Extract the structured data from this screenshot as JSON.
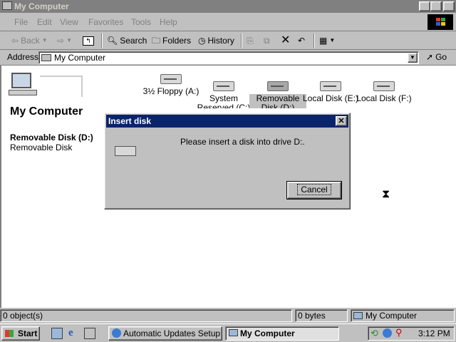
{
  "window": {
    "title": "My Computer"
  },
  "menu": [
    "File",
    "Edit",
    "View",
    "Favorites",
    "Tools",
    "Help"
  ],
  "toolbar": {
    "back": "Back",
    "search": "Search",
    "folders": "Folders",
    "history": "History"
  },
  "address": {
    "label": "Address",
    "value": "My Computer",
    "go": "Go"
  },
  "left_panel": {
    "title": "My Computer",
    "selected_name": "Removable Disk (D:)",
    "selected_type": "Removable Disk"
  },
  "drives": [
    {
      "label": "3½ Floppy (A:)"
    },
    {
      "label": "System Reserved (C:)"
    },
    {
      "label": "Removable Disk (D:)"
    },
    {
      "label": "Local Disk (E:)"
    },
    {
      "label": "Local Disk (F:)"
    }
  ],
  "dialog": {
    "title": "Insert disk",
    "message": "Please insert a disk into drive D:.",
    "cancel": "Cancel"
  },
  "status": {
    "objects": "0 object(s)",
    "size": "0 bytes",
    "zone": "My Computer"
  },
  "taskbar": {
    "start": "Start",
    "tasks": [
      "Automatic Updates Setup ...",
      "My Computer"
    ],
    "clock": "3:12 PM"
  }
}
